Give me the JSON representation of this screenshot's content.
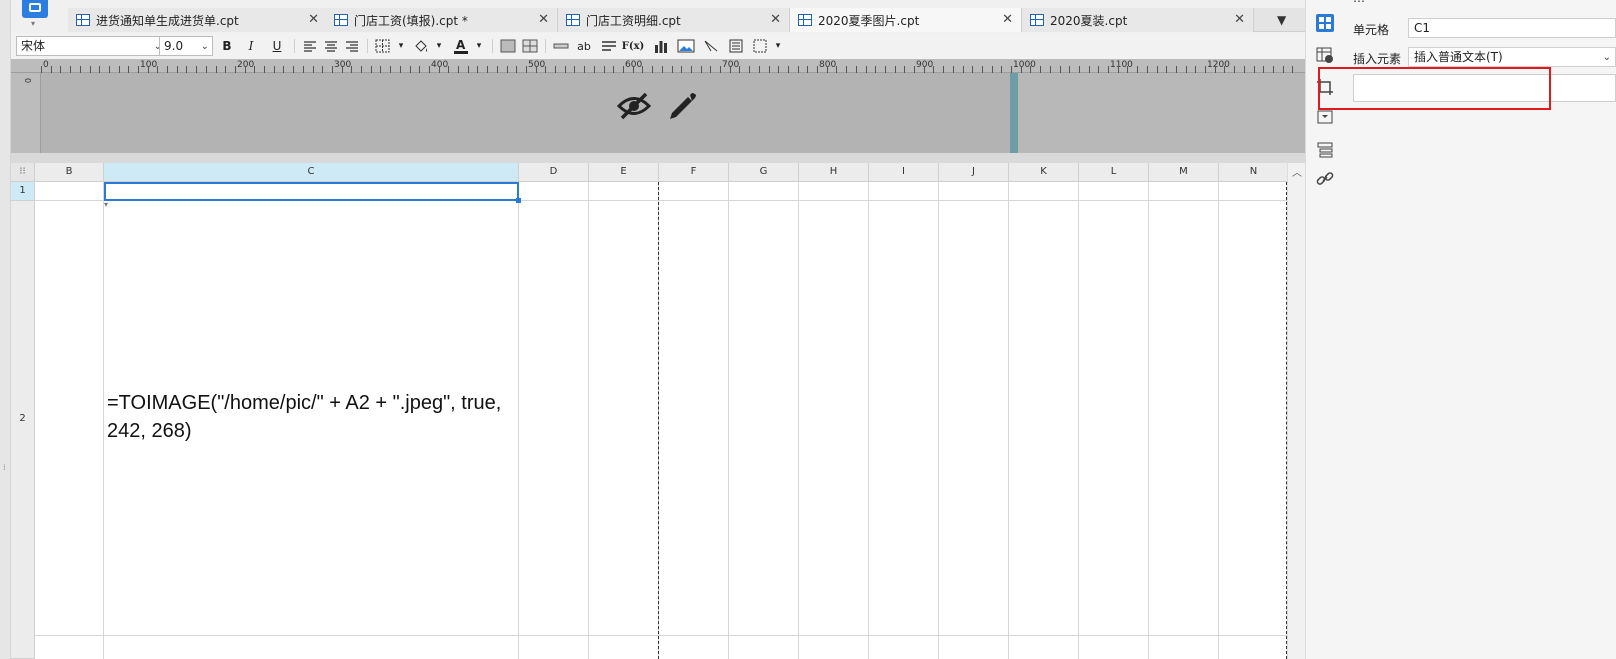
{
  "tabs": [
    {
      "label": "进货通知单生成进货单.cpt",
      "active": false
    },
    {
      "label": "门店工资(填报).cpt *",
      "active": false
    },
    {
      "label": "门店工资明细.cpt",
      "active": false
    },
    {
      "label": "2020夏季图片.cpt",
      "active": true
    },
    {
      "label": "2020夏装.cpt",
      "active": false
    }
  ],
  "toolbar": {
    "font_family": "宋体",
    "font_size": "9.0",
    "bold_label": "B",
    "italic_label": "I",
    "underline_label": "U",
    "text_label": "ab",
    "formula_label": "F(x)"
  },
  "ruler": {
    "horizontal_labels": [
      "0",
      "100",
      "200",
      "300",
      "400",
      "500",
      "600",
      "700",
      "800",
      "900",
      "1000",
      "1100",
      "1200"
    ],
    "vertical_label": "0"
  },
  "grid": {
    "columns": [
      "B",
      "C",
      "D",
      "E",
      "F",
      "G",
      "H",
      "I",
      "J",
      "K",
      "L",
      "M",
      "N"
    ],
    "rows": [
      "1",
      "2"
    ],
    "selected_cell": "C1",
    "cell_c2_text": "=TOIMAGE(\"/home/pic/\" + A2 + \".jpeg\", true, 242, 268)"
  },
  "properties": {
    "cell_label": "单元格",
    "cell_value": "C1",
    "insert_label": "插入元素",
    "insert_value": "插入普通文本(T)",
    "content_value": ""
  },
  "colors": {
    "accent": "#2a7ad8",
    "highlight_box": "#e0191b",
    "selected_header": "#cfeaf7"
  }
}
